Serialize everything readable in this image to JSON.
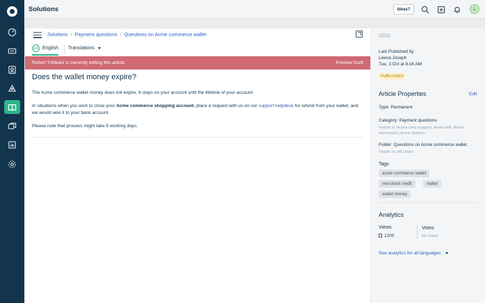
{
  "header": {
    "title": "Solutions",
    "ideas_label": "Ideas?",
    "avatar_initial": "L"
  },
  "rail": {
    "items": [
      "dashboard-icon",
      "tickets-icon",
      "contacts-icon",
      "groups-icon",
      "solutions-icon",
      "forums-icon",
      "reports-icon",
      "admin-icon"
    ],
    "active": "solutions-icon"
  },
  "breadcrumb": {
    "items": [
      "Solutions",
      "Payment questions",
      "Questions on Acme commerce wallet"
    ]
  },
  "language": {
    "badge": "EN",
    "label": "English",
    "translations_label": "Translations"
  },
  "banner": {
    "message": "Robert Tribbiani is currently editing this article.",
    "preview_label": "Preview Draft"
  },
  "article": {
    "title": "Does the wallet money expire?",
    "p1": "The Acme commerce wallet money does not expire. It stays on your account until the lifetime of your account.",
    "p2_a": "In situations when you wish to close your ",
    "p2_bold": "Acme commerce shopping account",
    "p2_b": ", place a request with us on our ",
    "p2_link": "support helpdesk",
    "p2_c": " for refund from your wallet, and we would wire it to your bank account.",
    "p3": "Please note that process might take 5 working days."
  },
  "sidebar": {
    "last_published_label": "Last Published by",
    "publisher": "Leena Joseph",
    "published_time": "Tue, 3 Oct at 8:16 AM",
    "status_badge": "PUBLISHED",
    "properties_heading": "Article Properties",
    "edit_label": "Edit",
    "type_line": "Type: Permanent",
    "category_line": "Category: Payment questions",
    "category_visible": "Visible in: Acme corp support, Acme doll, Acme electronics, Acme fashion",
    "folder_line": "Folder: Questions on Acme commerce wallet",
    "folder_visible": "Visible to: All Users",
    "tags_heading": "Tags",
    "tags": [
      "acme commerce wallet",
      "merchant credit",
      "wallet",
      "wallet money"
    ],
    "analytics_heading": "Analytics",
    "views_label": "Views",
    "views_value": "1200",
    "votes_label": "Votes",
    "votes_value": "No Votes",
    "analytics_link": "See analytics for all languages"
  },
  "colors": {
    "rail": "#12344d",
    "accent": "#2bb58a",
    "banner": "#d06a73",
    "link": "#2c5cc5"
  }
}
